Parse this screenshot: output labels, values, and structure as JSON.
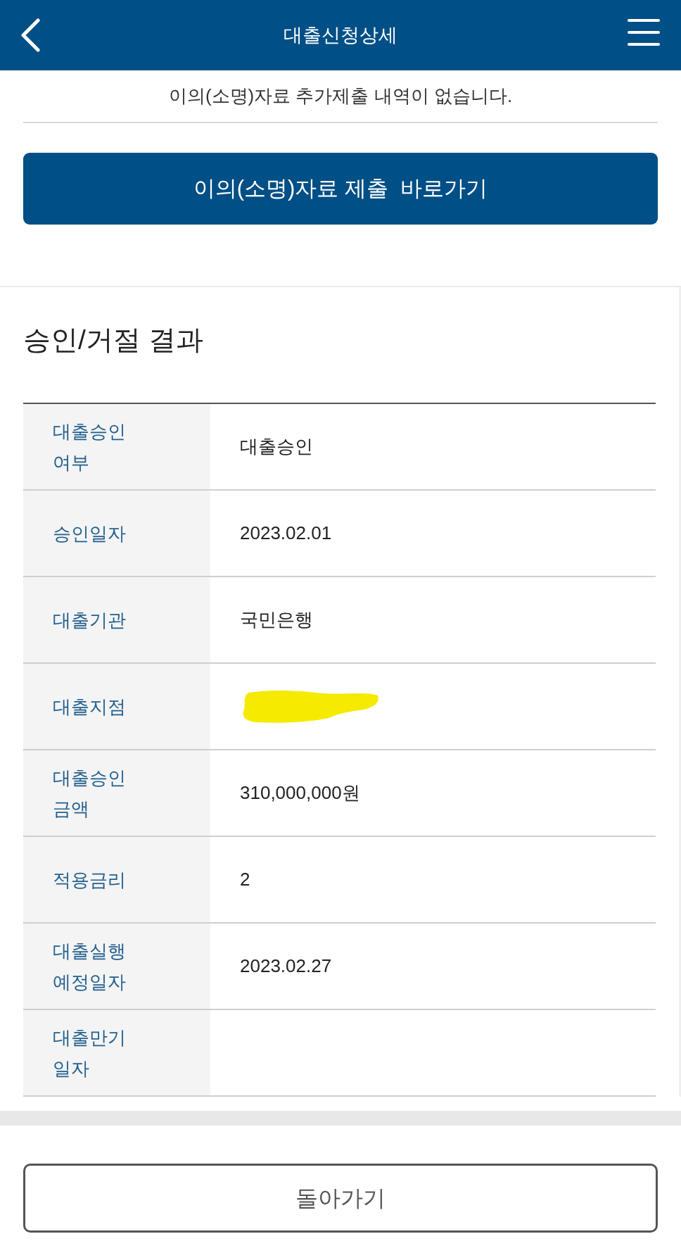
{
  "header": {
    "title": "대출신청상세"
  },
  "objection": {
    "notice": "이의(소명)자료 추가제출 내역이 없습니다.",
    "button": "이의(소명)자료 제출  바로가기"
  },
  "result": {
    "title": "승인/거절 결과",
    "rows": [
      {
        "label": "대출승인 여부",
        "value": "대출승인",
        "redacted": false
      },
      {
        "label": "승인일자",
        "value": "2023.02.01",
        "redacted": false
      },
      {
        "label": "대출기관",
        "value": "국민은행",
        "redacted": false
      },
      {
        "label": "대출지점",
        "redacted": true
      },
      {
        "label": "대출승인 금액",
        "value": "310,000,000원",
        "redacted": false
      },
      {
        "label": "적용금리",
        "value": "2",
        "redacted": false
      },
      {
        "label": "대출실행 예정일자",
        "value": "2023.02.27",
        "redacted": false
      },
      {
        "label": "대출만기 일자",
        "redacted": false
      }
    ]
  },
  "footer": {
    "button": "돌아가기"
  }
}
